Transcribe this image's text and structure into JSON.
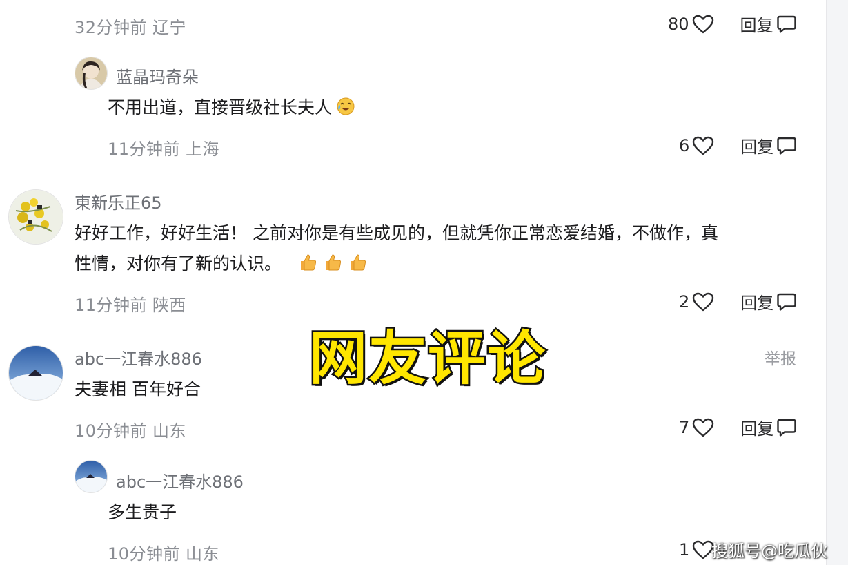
{
  "comments": [
    {
      "meta": {
        "time": "32分钟前",
        "region": "辽宁"
      },
      "likes": "80",
      "reply_label": "回复"
    },
    {
      "user": "蓝晶玛奇朵",
      "text": "不用出道，直接晋级社长夫人",
      "emoji": "laughing-crying-emoji",
      "meta": {
        "time": "11分钟前",
        "region": "上海"
      },
      "likes": "6",
      "reply_label": "回复"
    },
    {
      "user": "東新乐正65",
      "text_line1": "好好工作，好好生活！ 之前对你是有些成见的，但就凭你正常恋爱结婚，不做作，真",
      "text_line2": "性情，对你有了新的认识。",
      "emoji": "thumbs-up-emoji",
      "meta": {
        "time": "11分钟前",
        "region": "陕西"
      },
      "likes": "2",
      "reply_label": "回复"
    },
    {
      "user": "abc一江春水886",
      "text": "夫妻相 百年好合",
      "report_label": "举报",
      "meta": {
        "time": "10分钟前",
        "region": "山东"
      },
      "likes": "7",
      "reply_label": "回复"
    },
    {
      "user": "abc一江春水886",
      "text": "多生贵子",
      "meta": {
        "time": "10分钟前",
        "region": "山东"
      },
      "likes": "1"
    }
  ],
  "overlay": {
    "headline": "网友评论",
    "watermark": "搜狐号@吃瓜伙"
  },
  "colors": {
    "headline_fill": "#ffe600",
    "headline_stroke": "#111111",
    "meta_text": "#8a8d93",
    "username_text": "#6e7177",
    "content_text": "#1c1c1e"
  }
}
